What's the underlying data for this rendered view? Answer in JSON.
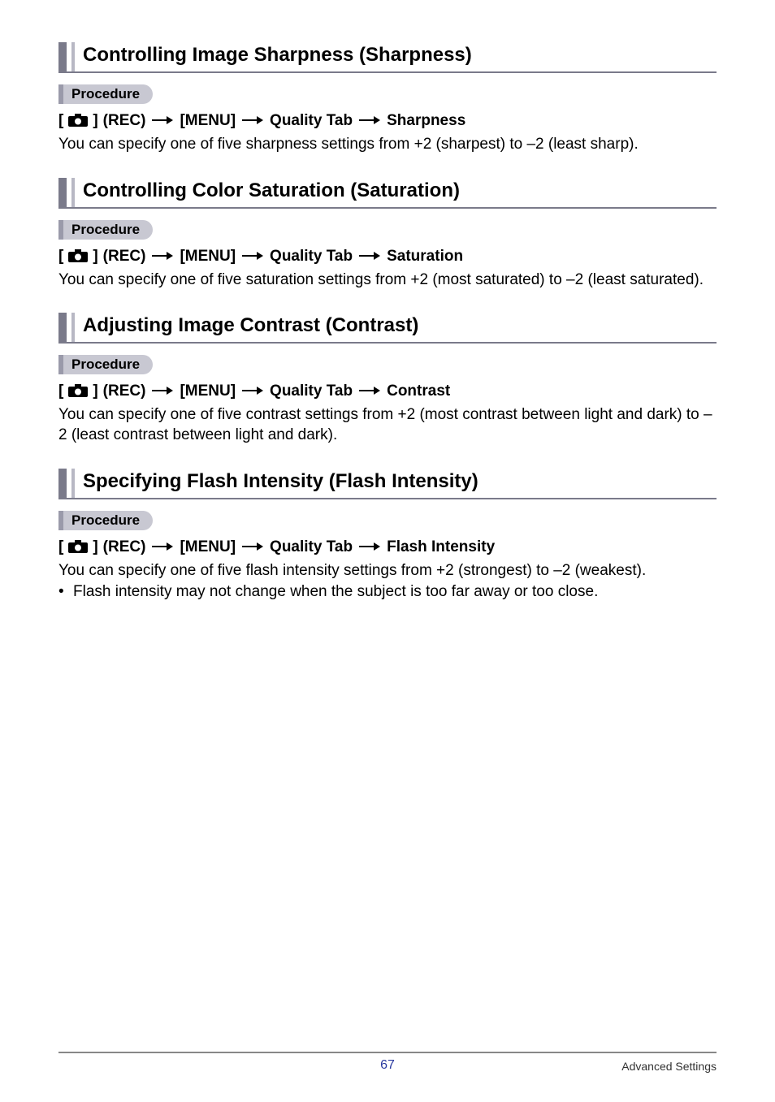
{
  "labels": {
    "procedure": "Procedure",
    "rec": "(REC)",
    "menu": "[MENU]",
    "quality_tab": "Quality Tab"
  },
  "sections": [
    {
      "title": "Controlling Image Sharpness (Sharpness)",
      "target": "Sharpness",
      "body": "You can specify one of five sharpness settings from +2 (sharpest) to –2 (least sharp).",
      "bullets": []
    },
    {
      "title": "Controlling Color Saturation (Saturation)",
      "target": "Saturation",
      "body": "You can specify one of five saturation settings from +2 (most saturated) to –2 (least saturated).",
      "bullets": []
    },
    {
      "title": "Adjusting Image Contrast (Contrast)",
      "target": "Contrast",
      "body": "You can specify one of five contrast settings from +2 (most contrast between light and dark) to –2 (least contrast between light and dark).",
      "bullets": []
    },
    {
      "title": "Specifying Flash Intensity (Flash Intensity)",
      "target": "Flash Intensity",
      "body": "You can specify one of five flash intensity settings from +2 (strongest) to –2 (weakest).",
      "bullets": [
        "Flash intensity may not change when the subject is too far away or too close."
      ]
    }
  ],
  "footer": {
    "page": "67",
    "section": "Advanced Settings"
  }
}
